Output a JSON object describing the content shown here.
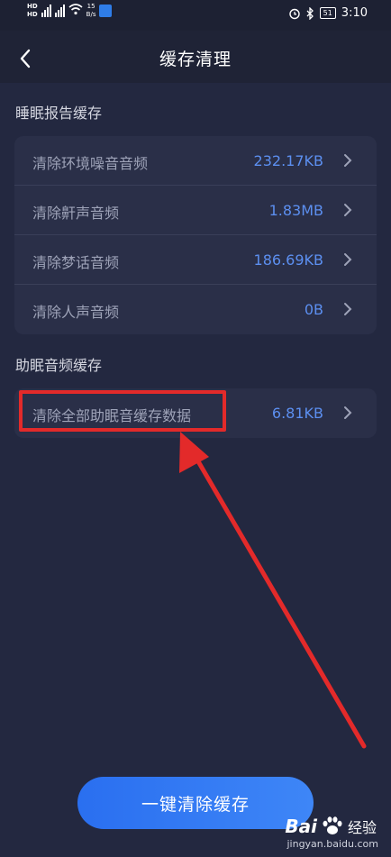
{
  "status_bar": {
    "network_speed_value": "15",
    "network_speed_unit": "B/s",
    "battery": "51",
    "time": "3:10"
  },
  "header": {
    "title": "缓存清理"
  },
  "sections": [
    {
      "title": "睡眠报告缓存",
      "items": [
        {
          "label": "清除环境噪音音频",
          "value": "232.17KB"
        },
        {
          "label": "清除鼾声音频",
          "value": "1.83MB"
        },
        {
          "label": "清除梦话音频",
          "value": "186.69KB"
        },
        {
          "label": "清除人声音频",
          "value": "0B"
        }
      ]
    },
    {
      "title": "助眠音频缓存",
      "items": [
        {
          "label": "清除全部助眠音缓存数据",
          "value": "6.81KB"
        }
      ]
    }
  ],
  "footer": {
    "clear_all_label": "一键清除缓存"
  },
  "watermark": {
    "brand": "Bai",
    "site_name": "经验",
    "url": "jingyan.baidu.com"
  },
  "colors": {
    "background": "#232840",
    "card": "#2a2f48",
    "value_text": "#5c8ff0",
    "button": "#3478f6",
    "annotation": "#e32a2a"
  },
  "icons": [
    "back-arrow-icon",
    "chevron-right-icon",
    "alarm-icon",
    "bluetooth-icon",
    "wifi-icon",
    "signal-icon",
    "paw-icon"
  ]
}
